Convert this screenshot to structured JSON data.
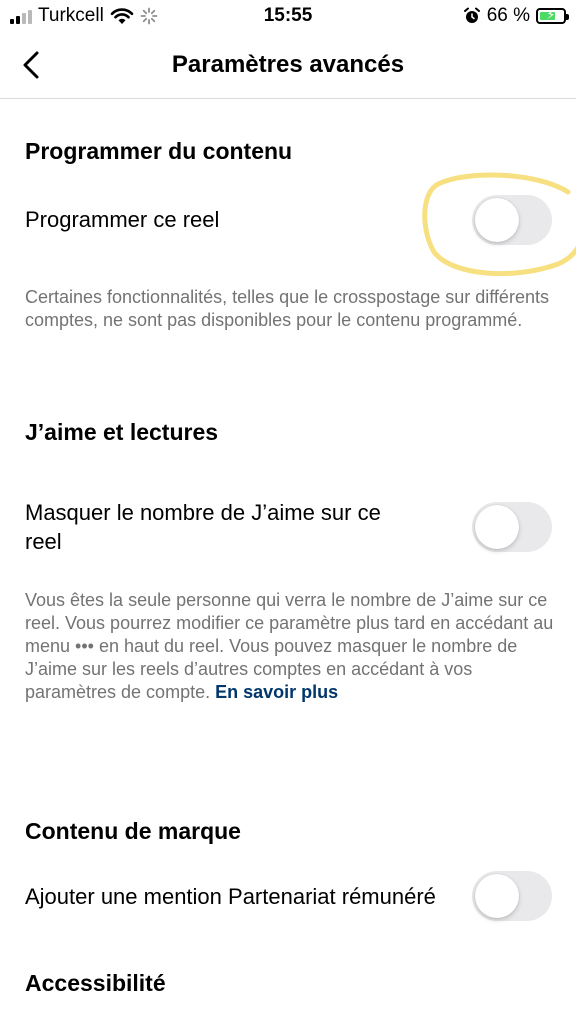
{
  "status_bar": {
    "carrier": "Turkcell",
    "time": "15:55",
    "battery_percent": "66 %",
    "battery_level": 0.66,
    "colors": {
      "battery_fill": "#4cd964"
    }
  },
  "nav": {
    "title": "Paramètres avancés"
  },
  "sections": {
    "schedule": {
      "title": "Programmer du contenu",
      "row_label": "Programmer ce reel",
      "toggle_on": false,
      "helper": "Certaines fonctionnalités, telles que le crosspostage sur différents comptes, ne sont pas disponibles pour le contenu programmé."
    },
    "likes": {
      "title": "J’aime et lectures",
      "row_label": "Masquer le nombre de J’aime sur ce reel",
      "toggle_on": false,
      "helper_part1": "Vous êtes la seule personne qui verra le nombre de J’aime sur ce reel. Vous pourrez modifier ce paramètre plus tard en accédant au menu",
      "helper_menu_glyph": "•••",
      "helper_part2": "en haut du reel. Vous pouvez masquer le nombre de J’aime sur les reels d’autres comptes en accédant à vos paramètres de compte.",
      "learn_more": "En savoir plus"
    },
    "branded": {
      "title": "Contenu de marque",
      "row_label": "Ajouter une mention Partenariat rémunéré",
      "toggle_on": false
    },
    "accessibility": {
      "title": "Accessibilité"
    }
  },
  "colors": {
    "link": "#00376b",
    "helper_text": "#737373",
    "toggle_off_track": "#e9e9eb",
    "highlight": "#f6dd73"
  }
}
